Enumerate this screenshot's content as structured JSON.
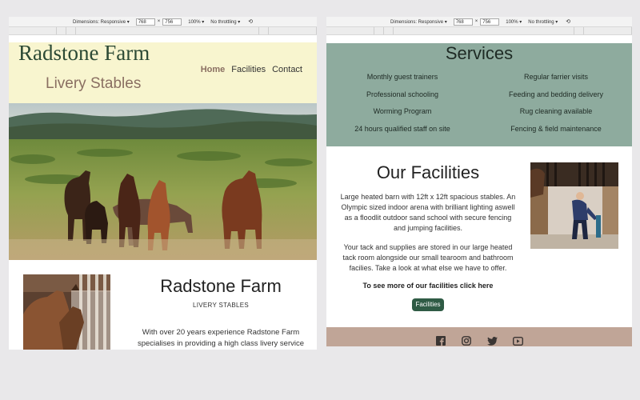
{
  "devtools": {
    "dimensions_label": "Dimensions: Responsive ▾",
    "width": "768",
    "times": "×",
    "height": "756",
    "zoom": "100% ▾",
    "throttling": "No throttling ▾",
    "rotate_icon": "rotate-icon"
  },
  "left": {
    "brand_title": "Radstone Farm",
    "brand_sub": "Livery Stables",
    "nav": [
      "Home",
      "Facilities",
      "Contact"
    ],
    "farm_title": "Radstone Farm",
    "farm_sub": "LIVERY STABLES",
    "farm_para": "With over 20 years experience Radstone Farm specialises in providing a high class livery service"
  },
  "right": {
    "services_title": "Services",
    "services": [
      "Monthly guest trainers",
      "Regular farrier visits",
      "Professional schooling",
      "Feeding and bedding delivery",
      "Worming Program",
      "Rug cleaning available",
      "24 hours qualified staff on site",
      "Fencing & field maintenance"
    ],
    "facilities_title": "Our Facilities",
    "facilities_para1": "Large heated barn with 12ft x 12ft spacious stables. An Olympic sized indoor arena with brilliant lighting aswell as a floodlit outdoor sand school with secure fencing and jumping facilities.",
    "facilities_para2": "Your tack and supplies are stored in our large heated tack room alongside our small tearoom and bathroom facilies. Take a look at what else we have to offer.",
    "facilities_link": "To see more of our facilities click here",
    "facilities_button": "Facilities"
  },
  "colors": {
    "header_bg": "#f8f5cf",
    "brand_green": "#2c4a35",
    "brand_brown": "#8a6f62",
    "services_bg": "#8eab9e",
    "footer_bg": "#c0a597",
    "button_bg": "#2f5b45"
  },
  "footer_icons": [
    "facebook-icon",
    "instagram-icon",
    "twitter-icon",
    "youtube-icon"
  ]
}
